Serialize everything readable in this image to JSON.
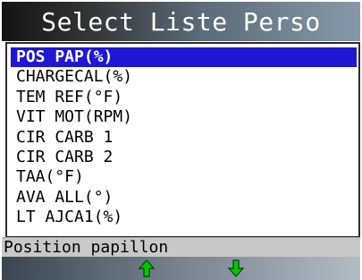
{
  "title": "Select Liste Perso",
  "list": {
    "items": [
      {
        "label": "POS PAP(%)",
        "selected": true
      },
      {
        "label": "CHARGECAL(%)",
        "selected": false
      },
      {
        "label": "TEM REF(°F)",
        "selected": false
      },
      {
        "label": "VIT MOT(RPM)",
        "selected": false
      },
      {
        "label": "CIR CARB 1",
        "selected": false
      },
      {
        "label": "CIR CARB 2",
        "selected": false
      },
      {
        "label": "TAA(°F)",
        "selected": false
      },
      {
        "label": "AVA ALL(°)",
        "selected": false
      },
      {
        "label": "LT AJCA1(%)",
        "selected": false
      }
    ]
  },
  "status": "Position papillon",
  "softkeys": [
    {
      "icon": "arrow-up-icon",
      "color": "#00c800"
    },
    {
      "icon": "arrow-down-icon",
      "color": "#00c800"
    }
  ],
  "colors": {
    "selection": "#1f17d4",
    "arrows": "#00c800"
  }
}
